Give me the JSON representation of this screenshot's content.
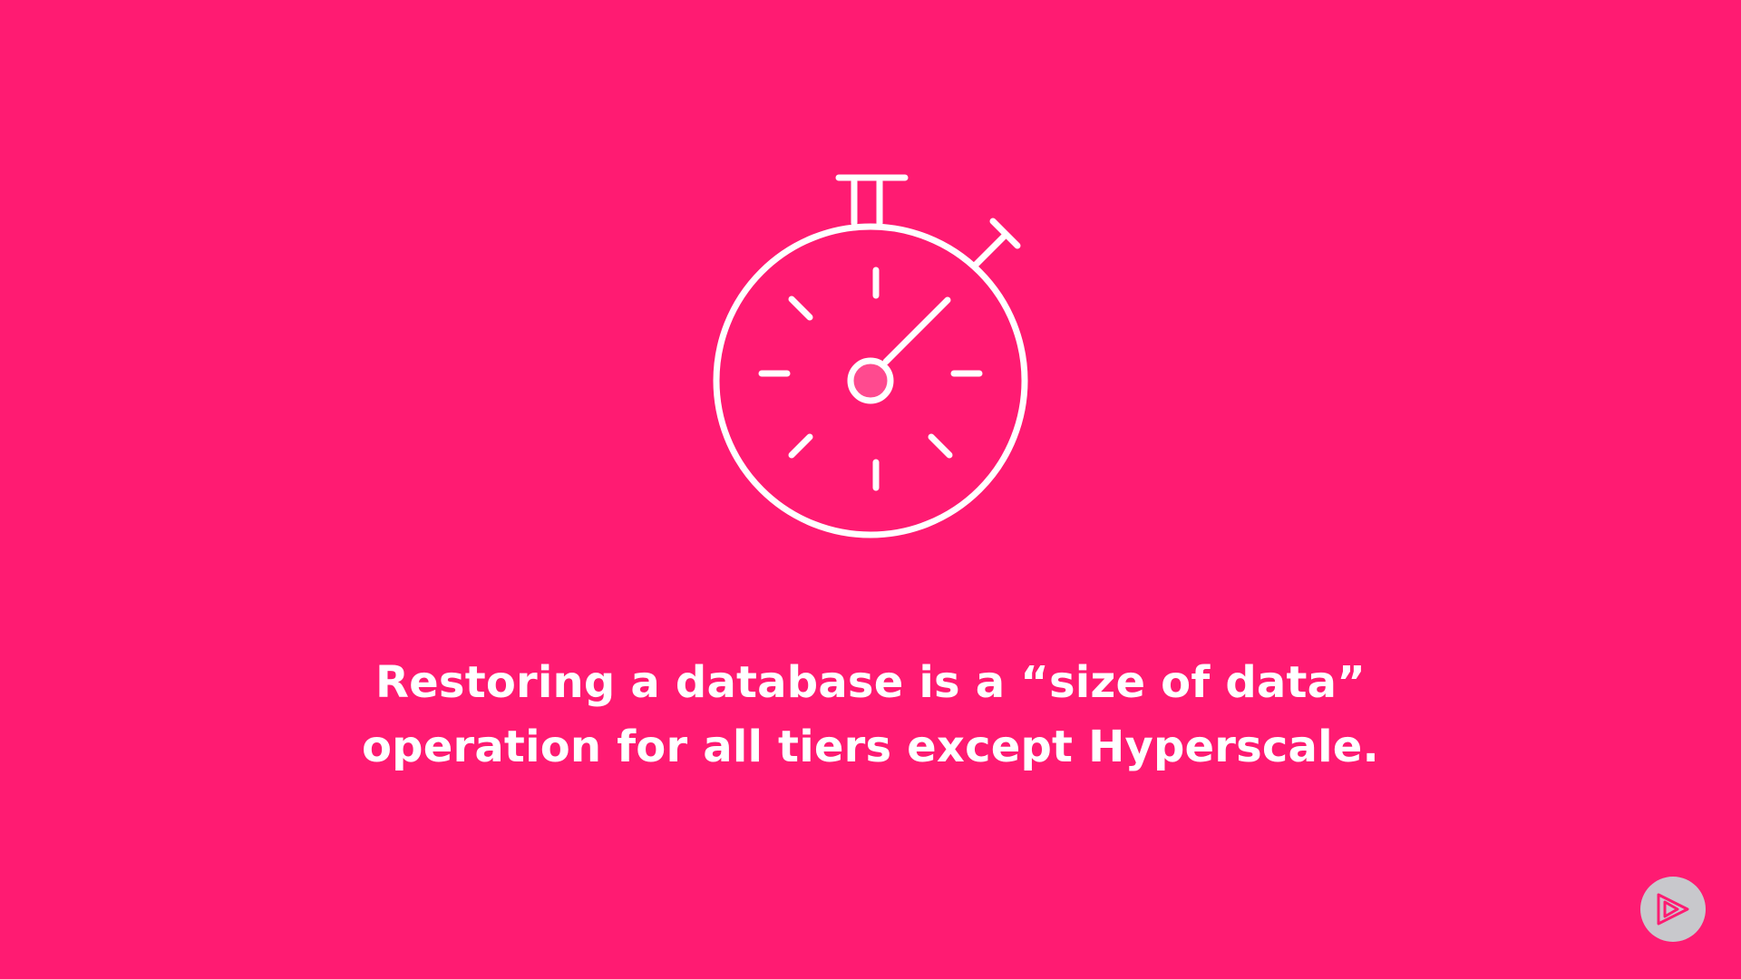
{
  "slide": {
    "background_color": "#FF1B72",
    "illustration_icon": "stopwatch-icon",
    "caption_lines": [
      "Restoring a database is a “size of data”",
      "operation for all tiers except Hyperscale."
    ],
    "text_color": "#FFFFFF"
  },
  "branding": {
    "icon": "play-logo-icon",
    "badge_color": "#C8C8CC",
    "logo_color": "#FF1B72"
  }
}
